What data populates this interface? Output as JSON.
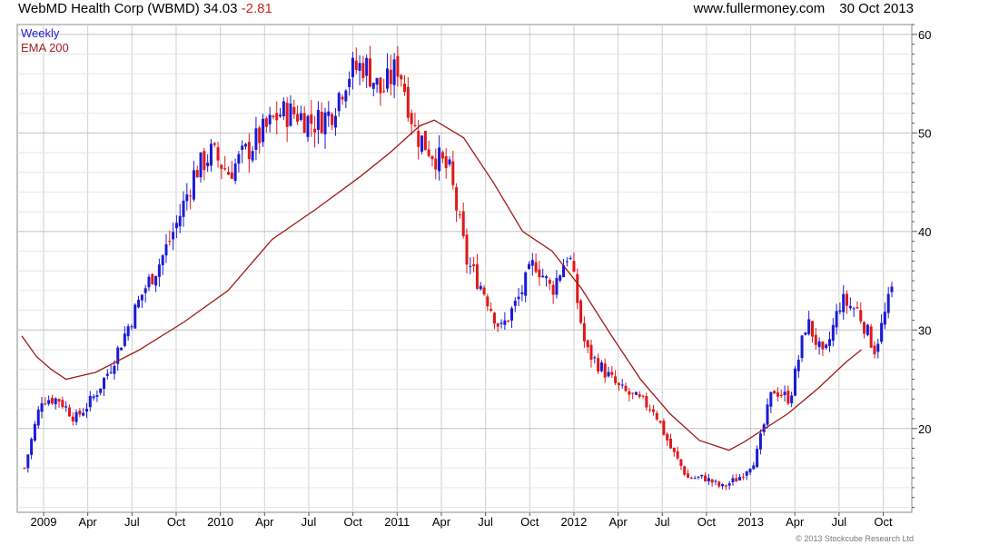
{
  "header": {
    "title": "WebMD Health Corp (WBMD) 34.03",
    "change": "-2.81",
    "site": "www.fullermoney.com",
    "date": "30 Oct 2013"
  },
  "legend": {
    "period": "Weekly",
    "ema": "EMA 200"
  },
  "footer": {
    "copyright": "© 2013 Stockcube Research Ltd"
  },
  "colors": {
    "up": "#1a1ad6",
    "down": "#e01818",
    "ema": "#a01818",
    "grid": "#d0d0d0"
  },
  "chart_data": {
    "type": "candlestick",
    "title": "WebMD Health Corp (WBMD) 34.03 -2.81",
    "x_ticks": [
      "2009",
      "Apr",
      "Jul",
      "Oct",
      "2010",
      "Apr",
      "Jul",
      "Oct",
      "2011",
      "Apr",
      "Jul",
      "Oct",
      "2012",
      "Apr",
      "Jul",
      "Oct",
      "2013",
      "Apr",
      "Jul",
      "Oct"
    ],
    "y_ticks": [
      20,
      30,
      40,
      50,
      60
    ],
    "ylim": [
      11.5,
      61
    ],
    "grid": true,
    "y_axis_side": "right",
    "series": [
      {
        "name": "Weekly",
        "price_path": [
          16,
          23,
          23,
          21,
          23,
          26,
          30,
          34,
          37,
          41,
          46,
          48,
          46,
          48,
          50,
          52,
          52,
          51,
          52,
          56,
          57,
          54,
          57,
          50,
          48,
          46,
          37,
          34,
          30,
          33,
          37,
          34,
          38,
          28,
          26,
          24,
          23,
          22,
          18,
          15,
          15,
          14,
          15,
          17,
          24,
          23,
          31,
          27,
          33,
          32,
          28,
          34
        ]
      },
      {
        "name": "EMA 200",
        "points": [
          {
            "x": "2009-01",
            "y": 29.4
          },
          {
            "x": "2009-02",
            "y": 27.3
          },
          {
            "x": "2009-03",
            "y": 26.0
          },
          {
            "x": "2009-04",
            "y": 25.0
          },
          {
            "x": "2009-06",
            "y": 25.7
          },
          {
            "x": "2009-09",
            "y": 28.0
          },
          {
            "x": "2009-12",
            "y": 30.8
          },
          {
            "x": "2010-03",
            "y": 34.0
          },
          {
            "x": "2010-06",
            "y": 39.2
          },
          {
            "x": "2010-09",
            "y": 42.3
          },
          {
            "x": "2010-12",
            "y": 45.6
          },
          {
            "x": "2011-02",
            "y": 48.0
          },
          {
            "x": "2011-04",
            "y": 50.7
          },
          {
            "x": "2011-05",
            "y": 51.3
          },
          {
            "x": "2011-07",
            "y": 49.5
          },
          {
            "x": "2011-09",
            "y": 45.0
          },
          {
            "x": "2011-11",
            "y": 40.0
          },
          {
            "x": "2012-01",
            "y": 38.0
          },
          {
            "x": "2012-03",
            "y": 34.2
          },
          {
            "x": "2012-05",
            "y": 29.5
          },
          {
            "x": "2012-07",
            "y": 25.0
          },
          {
            "x": "2012-09",
            "y": 21.5
          },
          {
            "x": "2012-11",
            "y": 18.8
          },
          {
            "x": "2013-01",
            "y": 17.8
          },
          {
            "x": "2013-02",
            "y": 18.6
          },
          {
            "x": "2013-05",
            "y": 21.5
          },
          {
            "x": "2013-07",
            "y": 24.0
          },
          {
            "x": "2013-09",
            "y": 26.8
          },
          {
            "x": "2013-10",
            "y": 28.0
          }
        ]
      }
    ]
  }
}
